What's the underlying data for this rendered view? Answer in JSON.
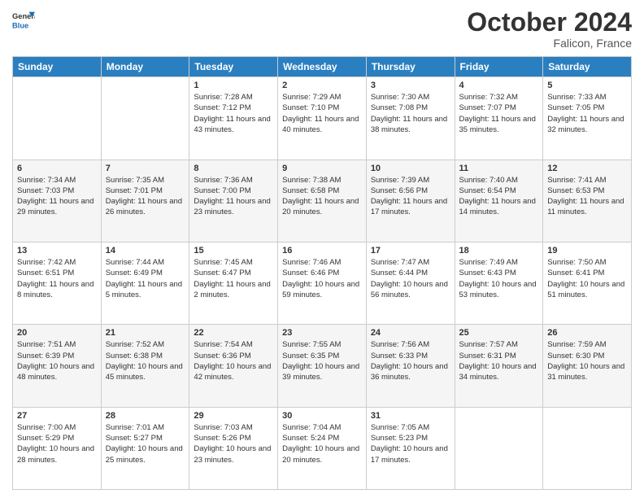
{
  "logo": {
    "general": "General",
    "blue": "Blue"
  },
  "header": {
    "month": "October 2024",
    "location": "Falicon, France"
  },
  "columns": [
    "Sunday",
    "Monday",
    "Tuesday",
    "Wednesday",
    "Thursday",
    "Friday",
    "Saturday"
  ],
  "weeks": [
    [
      {
        "day": "",
        "sunrise": "",
        "sunset": "",
        "daylight": ""
      },
      {
        "day": "",
        "sunrise": "",
        "sunset": "",
        "daylight": ""
      },
      {
        "day": "1",
        "sunrise": "Sunrise: 7:28 AM",
        "sunset": "Sunset: 7:12 PM",
        "daylight": "Daylight: 11 hours and 43 minutes."
      },
      {
        "day": "2",
        "sunrise": "Sunrise: 7:29 AM",
        "sunset": "Sunset: 7:10 PM",
        "daylight": "Daylight: 11 hours and 40 minutes."
      },
      {
        "day": "3",
        "sunrise": "Sunrise: 7:30 AM",
        "sunset": "Sunset: 7:08 PM",
        "daylight": "Daylight: 11 hours and 38 minutes."
      },
      {
        "day": "4",
        "sunrise": "Sunrise: 7:32 AM",
        "sunset": "Sunset: 7:07 PM",
        "daylight": "Daylight: 11 hours and 35 minutes."
      },
      {
        "day": "5",
        "sunrise": "Sunrise: 7:33 AM",
        "sunset": "Sunset: 7:05 PM",
        "daylight": "Daylight: 11 hours and 32 minutes."
      }
    ],
    [
      {
        "day": "6",
        "sunrise": "Sunrise: 7:34 AM",
        "sunset": "Sunset: 7:03 PM",
        "daylight": "Daylight: 11 hours and 29 minutes."
      },
      {
        "day": "7",
        "sunrise": "Sunrise: 7:35 AM",
        "sunset": "Sunset: 7:01 PM",
        "daylight": "Daylight: 11 hours and 26 minutes."
      },
      {
        "day": "8",
        "sunrise": "Sunrise: 7:36 AM",
        "sunset": "Sunset: 7:00 PM",
        "daylight": "Daylight: 11 hours and 23 minutes."
      },
      {
        "day": "9",
        "sunrise": "Sunrise: 7:38 AM",
        "sunset": "Sunset: 6:58 PM",
        "daylight": "Daylight: 11 hours and 20 minutes."
      },
      {
        "day": "10",
        "sunrise": "Sunrise: 7:39 AM",
        "sunset": "Sunset: 6:56 PM",
        "daylight": "Daylight: 11 hours and 17 minutes."
      },
      {
        "day": "11",
        "sunrise": "Sunrise: 7:40 AM",
        "sunset": "Sunset: 6:54 PM",
        "daylight": "Daylight: 11 hours and 14 minutes."
      },
      {
        "day": "12",
        "sunrise": "Sunrise: 7:41 AM",
        "sunset": "Sunset: 6:53 PM",
        "daylight": "Daylight: 11 hours and 11 minutes."
      }
    ],
    [
      {
        "day": "13",
        "sunrise": "Sunrise: 7:42 AM",
        "sunset": "Sunset: 6:51 PM",
        "daylight": "Daylight: 11 hours and 8 minutes."
      },
      {
        "day": "14",
        "sunrise": "Sunrise: 7:44 AM",
        "sunset": "Sunset: 6:49 PM",
        "daylight": "Daylight: 11 hours and 5 minutes."
      },
      {
        "day": "15",
        "sunrise": "Sunrise: 7:45 AM",
        "sunset": "Sunset: 6:47 PM",
        "daylight": "Daylight: 11 hours and 2 minutes."
      },
      {
        "day": "16",
        "sunrise": "Sunrise: 7:46 AM",
        "sunset": "Sunset: 6:46 PM",
        "daylight": "Daylight: 10 hours and 59 minutes."
      },
      {
        "day": "17",
        "sunrise": "Sunrise: 7:47 AM",
        "sunset": "Sunset: 6:44 PM",
        "daylight": "Daylight: 10 hours and 56 minutes."
      },
      {
        "day": "18",
        "sunrise": "Sunrise: 7:49 AM",
        "sunset": "Sunset: 6:43 PM",
        "daylight": "Daylight: 10 hours and 53 minutes."
      },
      {
        "day": "19",
        "sunrise": "Sunrise: 7:50 AM",
        "sunset": "Sunset: 6:41 PM",
        "daylight": "Daylight: 10 hours and 51 minutes."
      }
    ],
    [
      {
        "day": "20",
        "sunrise": "Sunrise: 7:51 AM",
        "sunset": "Sunset: 6:39 PM",
        "daylight": "Daylight: 10 hours and 48 minutes."
      },
      {
        "day": "21",
        "sunrise": "Sunrise: 7:52 AM",
        "sunset": "Sunset: 6:38 PM",
        "daylight": "Daylight: 10 hours and 45 minutes."
      },
      {
        "day": "22",
        "sunrise": "Sunrise: 7:54 AM",
        "sunset": "Sunset: 6:36 PM",
        "daylight": "Daylight: 10 hours and 42 minutes."
      },
      {
        "day": "23",
        "sunrise": "Sunrise: 7:55 AM",
        "sunset": "Sunset: 6:35 PM",
        "daylight": "Daylight: 10 hours and 39 minutes."
      },
      {
        "day": "24",
        "sunrise": "Sunrise: 7:56 AM",
        "sunset": "Sunset: 6:33 PM",
        "daylight": "Daylight: 10 hours and 36 minutes."
      },
      {
        "day": "25",
        "sunrise": "Sunrise: 7:57 AM",
        "sunset": "Sunset: 6:31 PM",
        "daylight": "Daylight: 10 hours and 34 minutes."
      },
      {
        "day": "26",
        "sunrise": "Sunrise: 7:59 AM",
        "sunset": "Sunset: 6:30 PM",
        "daylight": "Daylight: 10 hours and 31 minutes."
      }
    ],
    [
      {
        "day": "27",
        "sunrise": "Sunrise: 7:00 AM",
        "sunset": "Sunset: 5:29 PM",
        "daylight": "Daylight: 10 hours and 28 minutes."
      },
      {
        "day": "28",
        "sunrise": "Sunrise: 7:01 AM",
        "sunset": "Sunset: 5:27 PM",
        "daylight": "Daylight: 10 hours and 25 minutes."
      },
      {
        "day": "29",
        "sunrise": "Sunrise: 7:03 AM",
        "sunset": "Sunset: 5:26 PM",
        "daylight": "Daylight: 10 hours and 23 minutes."
      },
      {
        "day": "30",
        "sunrise": "Sunrise: 7:04 AM",
        "sunset": "Sunset: 5:24 PM",
        "daylight": "Daylight: 10 hours and 20 minutes."
      },
      {
        "day": "31",
        "sunrise": "Sunrise: 7:05 AM",
        "sunset": "Sunset: 5:23 PM",
        "daylight": "Daylight: 10 hours and 17 minutes."
      },
      {
        "day": "",
        "sunrise": "",
        "sunset": "",
        "daylight": ""
      },
      {
        "day": "",
        "sunrise": "",
        "sunset": "",
        "daylight": ""
      }
    ]
  ]
}
